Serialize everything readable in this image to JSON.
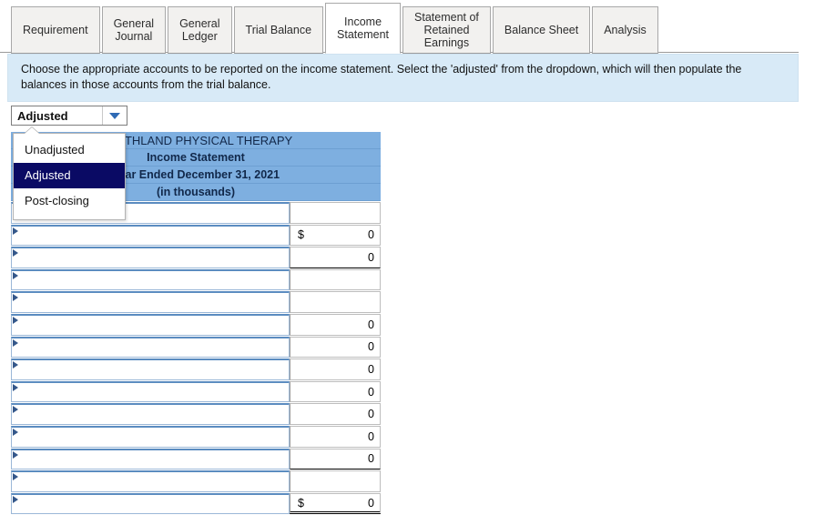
{
  "tabs": [
    {
      "label": "Requirement",
      "active": false
    },
    {
      "label": "General\nJournal",
      "active": false
    },
    {
      "label": "General\nLedger",
      "active": false
    },
    {
      "label": "Trial Balance",
      "active": false
    },
    {
      "label": "Income\nStatement",
      "active": true
    },
    {
      "label": "Statement of\nRetained\nEarnings",
      "active": false
    },
    {
      "label": "Balance Sheet",
      "active": false
    },
    {
      "label": "Analysis",
      "active": false
    }
  ],
  "banner": {
    "text": "Choose the appropriate accounts to be reported on the income statement. Select the 'adjusted' from the dropdown, which will then populate the balances in those accounts from the trial balance."
  },
  "select": {
    "value": "Adjusted",
    "arrow_icon": "chevron-down-icon",
    "open": true,
    "options": [
      {
        "label": "Unadjusted",
        "selected": false
      },
      {
        "label": "Adjusted",
        "selected": true
      },
      {
        "label": "Post-closing",
        "selected": false
      }
    ]
  },
  "statement": {
    "header_lines": [
      "SOUTHLAND PHYSICAL THERAPY",
      "Income Statement",
      "Year Ended December 31, 2021",
      "(in thousands)"
    ],
    "row_marker_icon": "expand-triangle-icon",
    "rows": [
      {
        "name": "",
        "currency": "",
        "value": "",
        "marker": false,
        "amt_style": "blank-first"
      },
      {
        "name": "",
        "currency": "$",
        "value": "0",
        "marker": true,
        "amt_style": ""
      },
      {
        "name": "",
        "currency": "",
        "value": "0",
        "marker": true,
        "amt_style": "ul"
      },
      {
        "name": "",
        "currency": "",
        "value": "",
        "marker": true,
        "amt_style": ""
      },
      {
        "name": "",
        "currency": "",
        "value": "",
        "marker": true,
        "amt_style": ""
      },
      {
        "name": "",
        "currency": "",
        "value": "0",
        "marker": true,
        "amt_style": ""
      },
      {
        "name": "",
        "currency": "",
        "value": "0",
        "marker": true,
        "amt_style": ""
      },
      {
        "name": "",
        "currency": "",
        "value": "0",
        "marker": true,
        "amt_style": ""
      },
      {
        "name": "",
        "currency": "",
        "value": "0",
        "marker": true,
        "amt_style": ""
      },
      {
        "name": "",
        "currency": "",
        "value": "0",
        "marker": true,
        "amt_style": ""
      },
      {
        "name": "",
        "currency": "",
        "value": "0",
        "marker": true,
        "amt_style": ""
      },
      {
        "name": "",
        "currency": "",
        "value": "0",
        "marker": true,
        "amt_style": "ul"
      },
      {
        "name": "",
        "currency": "",
        "value": "",
        "marker": true,
        "amt_style": ""
      },
      {
        "name": "",
        "currency": "$",
        "value": "0",
        "marker": true,
        "amt_style": "dbl"
      }
    ]
  },
  "colors": {
    "header_blue": "#7eafe0",
    "banner_blue": "#d8eaf7",
    "menu_select": "#0a0a64",
    "row_border": "#5b8cc0"
  }
}
